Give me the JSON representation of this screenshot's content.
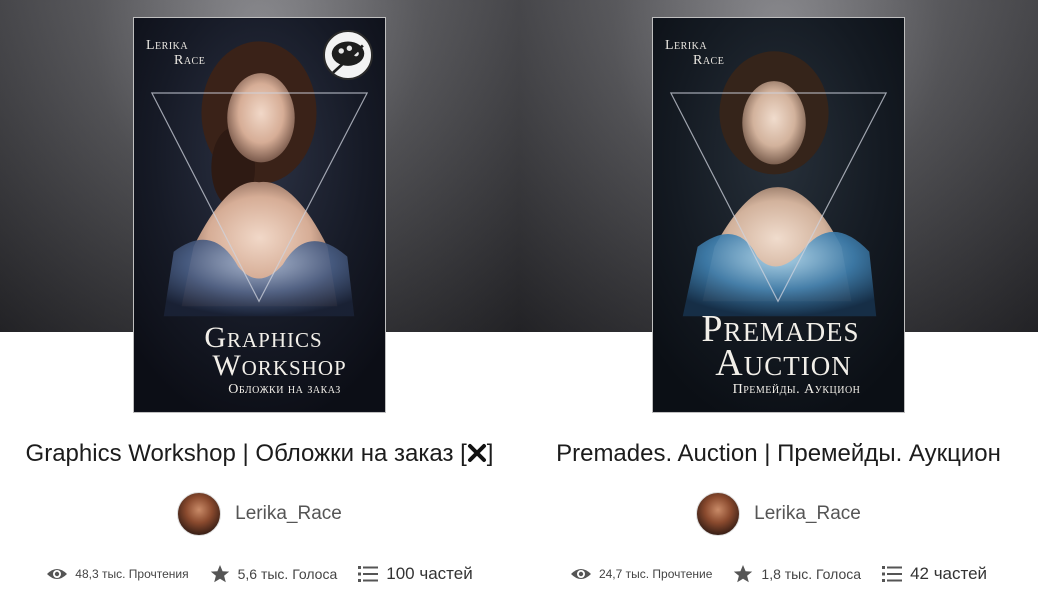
{
  "colors": {
    "hero_bg": "#4a4a4e",
    "cover_bg": "#121420",
    "title_text": "#1c1c1c",
    "author_text": "#555555",
    "stat_text": "#444444"
  },
  "books": [
    {
      "cover": {
        "author_line1": "Lerika",
        "author_line2": "Race",
        "title_line1": "Graphics",
        "title_line2": "Workshop",
        "subtitle": "Обложки на заказ",
        "badge_icon": "association-badge-icon"
      },
      "title": "Graphics Workshop | Обложки на заказ [",
      "title_suffix": "]",
      "title_icon": "close-icon",
      "author_name": "Lerika_Race",
      "stats": {
        "reads": "48,3 тыс. Прочтения",
        "votes": "5,6 тыс. Голоса",
        "parts": "100 частей"
      }
    },
    {
      "cover": {
        "author_line1": "Lerika",
        "author_line2": "Race",
        "title_line1": "Premades",
        "title_line2": "Auction",
        "subtitle": "Премейды. Аукцион"
      },
      "title": "Premades. Auction | Премейды. Аукцион",
      "author_name": "Lerika_Race",
      "stats": {
        "reads": "24,7 тыс. Прочтение",
        "votes": "1,8 тыс. Голоса",
        "parts": "42 частей"
      }
    }
  ]
}
